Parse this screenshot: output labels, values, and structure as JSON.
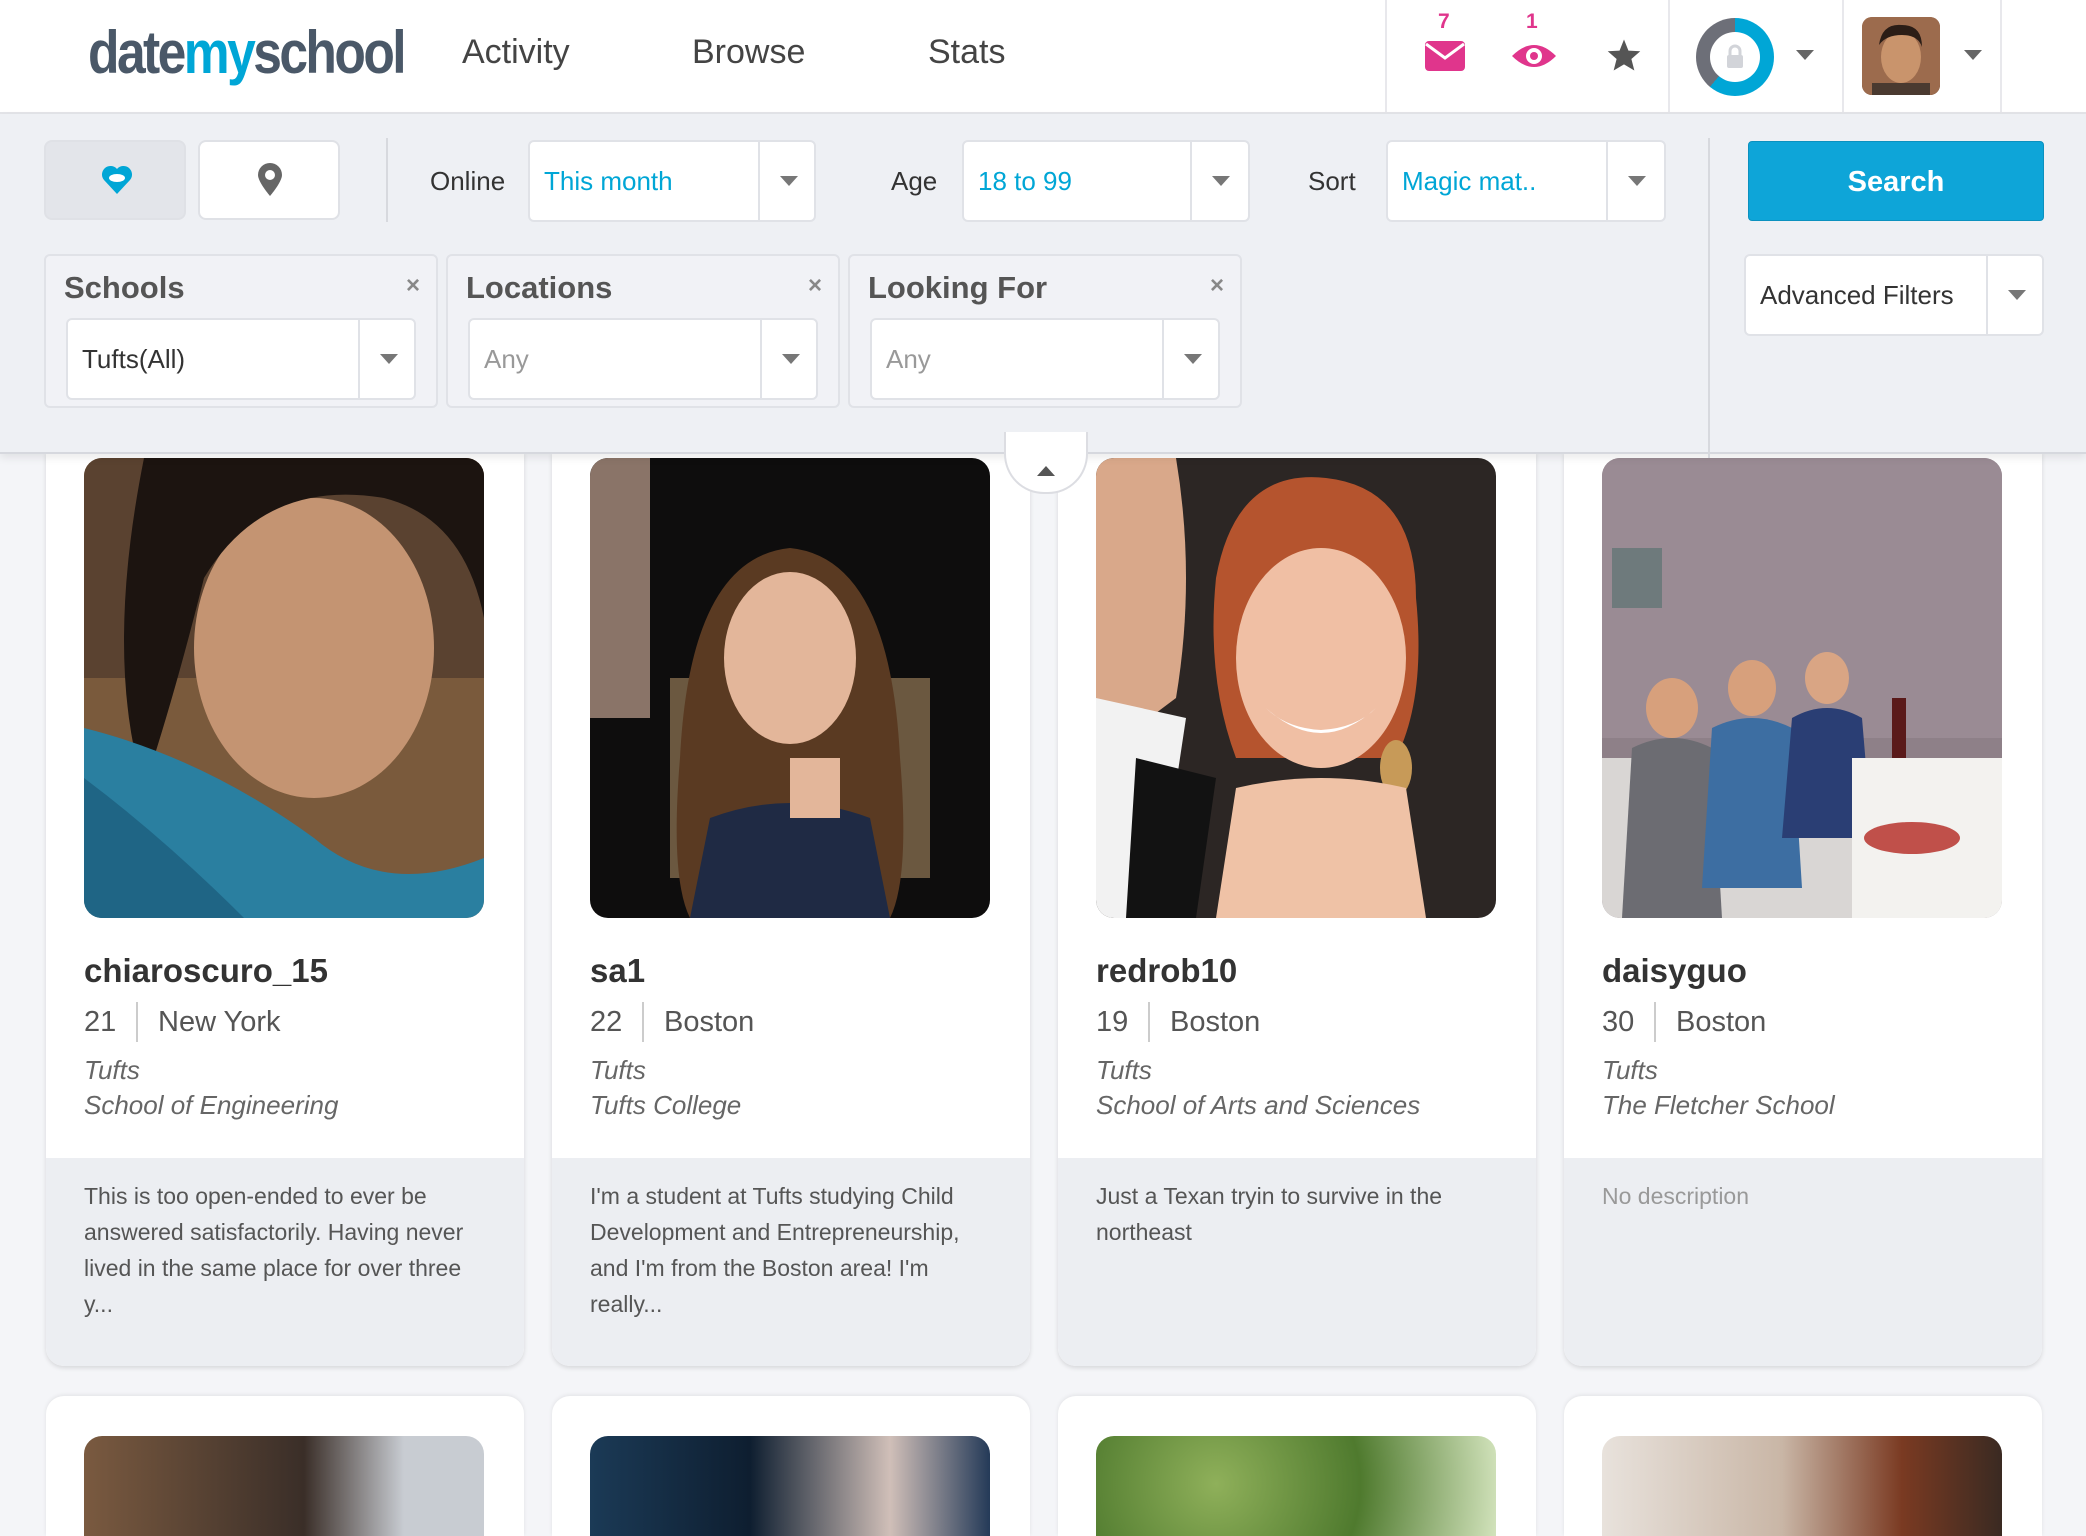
{
  "nav": {
    "logo_prefix": "date",
    "logo_mid": "my",
    "logo_suffix": "school",
    "links": [
      "Activity",
      "Browse",
      "Stats"
    ],
    "messages_count": "7",
    "views_count": "1",
    "colors": {
      "accent": "#00a6d6",
      "badge": "#e0358c"
    }
  },
  "filters": {
    "online_label": "Online",
    "online_value": "This month",
    "age_label": "Age",
    "age_value": "18 to 99",
    "sort_label": "Sort",
    "sort_value": "Magic mat..",
    "search_label": "Search",
    "schools_title": "Schools",
    "schools_value": "Tufts(All)",
    "locations_title": "Locations",
    "locations_value": "Any",
    "looking_title": "Looking For",
    "looking_value": "Any",
    "advanced_label": "Advanced Filters",
    "close_glyph": "×"
  },
  "profiles": [
    {
      "username": "chiaroscuro_15",
      "age": "21",
      "city": "New York",
      "school": "Tufts",
      "department": "School of Engineering",
      "description": "This is too open-ended to ever be answered satisfactorily. Having never lived in the same place for over three y..."
    },
    {
      "username": "sa1",
      "age": "22",
      "city": "Boston",
      "school": "Tufts",
      "department": "Tufts College",
      "description": "I'm a student at Tufts studying Child Development and Entrepreneurship, and I'm from the Boston area! I'm really..."
    },
    {
      "username": "redrob10",
      "age": "19",
      "city": "Boston",
      "school": "Tufts",
      "department": "School of Arts and Sciences",
      "description": "Just a Texan tryin to survive in the northeast"
    },
    {
      "username": "daisyguo",
      "age": "30",
      "city": "Boston",
      "school": "Tufts",
      "department": "The Fletcher School",
      "description": "No description"
    }
  ]
}
